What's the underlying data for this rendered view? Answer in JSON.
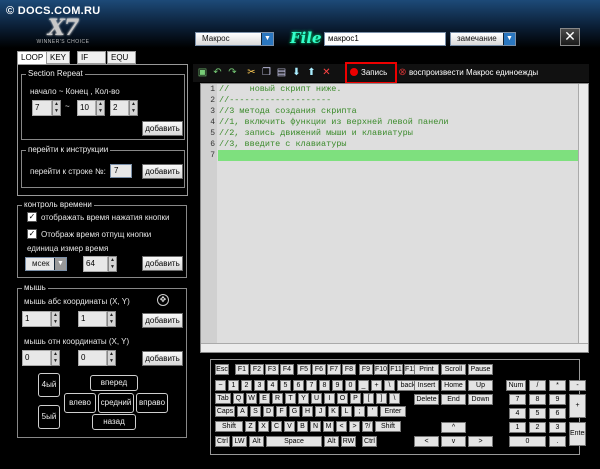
{
  "watermark": "© DOCS.COM.RU",
  "logo": {
    "model": "X7",
    "tagline": "WINNER'S CHOICE"
  },
  "header": {
    "mode": "Макрос",
    "file_logo": "File",
    "file_name": "макрос1",
    "note": "замечание"
  },
  "tabs": [
    "LOOP",
    "KEY",
    "IF",
    "EQU"
  ],
  "section_repeat": {
    "title": "Section Repeat",
    "label": "начало ~ Конец , Кол-во",
    "start": "7",
    "sep": "~",
    "end": "10",
    "count": "2",
    "add": "добавить"
  },
  "goto": {
    "title": "перейти к инструкции",
    "label": "перейти к строке №:",
    "line": "7",
    "add": "добавить"
  },
  "time_ctrl": {
    "title": "контроль времени",
    "opt1": "отображать время нажатия кнопки",
    "opt2": "Отображ время отпущ кнопки",
    "unit_label": "единица измер  время",
    "unit": "мсек",
    "value": "64",
    "add": "добавить"
  },
  "mouse": {
    "title": "мышь",
    "abs_label": "мышь абс координаты (X, Y)",
    "abs_x": "1",
    "abs_y": "1",
    "rel_label": "мышь отн координаты (X, Y)",
    "rel_x": "0",
    "rel_y": "0",
    "add1": "добавить",
    "add2": "добавить",
    "btn4": "4ый",
    "btn5": "5ый",
    "fwd": "вперед",
    "left": "влево",
    "mid": "средний",
    "right": "вправо",
    "back": "назад"
  },
  "toolbar": {
    "record": "Запись",
    "replay": "воспроизвести Макрос единоежды"
  },
  "editor": {
    "lines": [
      {
        "n": "1",
        "t": "//    новый скрипт ниже."
      },
      {
        "n": "2",
        "t": "//--------------------"
      },
      {
        "n": "3",
        "t": "//3 метода создания скрипта"
      },
      {
        "n": "4",
        "t": "//1, включить функции из верхней левой панели"
      },
      {
        "n": "5",
        "t": "//2, запись движений мыши и клавиатуры"
      },
      {
        "n": "6",
        "t": "//3, введите с клавиатуры"
      },
      {
        "n": "7",
        "t": ""
      }
    ]
  },
  "keyboard": {
    "row1": [
      "Esc",
      "F1",
      "F2",
      "F3",
      "F4",
      "F5",
      "F6",
      "F7",
      "F8",
      "F9",
      "F10",
      "F11",
      "F12"
    ],
    "row1b": [
      "Print",
      "Scroll",
      "Pause"
    ],
    "row2": [
      "~",
      "1",
      "2",
      "3",
      "4",
      "5",
      "6",
      "7",
      "8",
      "9",
      "0",
      "_",
      "+",
      "\\",
      "back"
    ],
    "row3": [
      "Tab",
      "Q",
      "W",
      "E",
      "R",
      "T",
      "Y",
      "U",
      "I",
      "O",
      "P",
      "[",
      "]",
      "\\"
    ],
    "row4": [
      "Caps",
      "A",
      "S",
      "D",
      "F",
      "G",
      "H",
      "J",
      "K",
      "L",
      ";",
      "'",
      "Enter"
    ],
    "row5": [
      "Shift",
      "Z",
      "X",
      "C",
      "V",
      "B",
      "N",
      "M",
      "<",
      ">",
      "?/",
      "Shift"
    ],
    "row6": [
      "Ctrl",
      "LW",
      "Alt",
      "Space",
      "Alt",
      "RW",
      "Ctrl"
    ],
    "nav": [
      "Insert",
      "Home",
      "Up",
      "Delete",
      "End",
      "Down"
    ],
    "arrows": [
      "^",
      "<",
      "v",
      ">"
    ],
    "num": [
      "Num",
      "/",
      "*",
      "-",
      "7",
      "8",
      "9",
      "+",
      "4",
      "5",
      "6",
      "1",
      "2",
      "3",
      "Enter",
      "0",
      "."
    ]
  }
}
